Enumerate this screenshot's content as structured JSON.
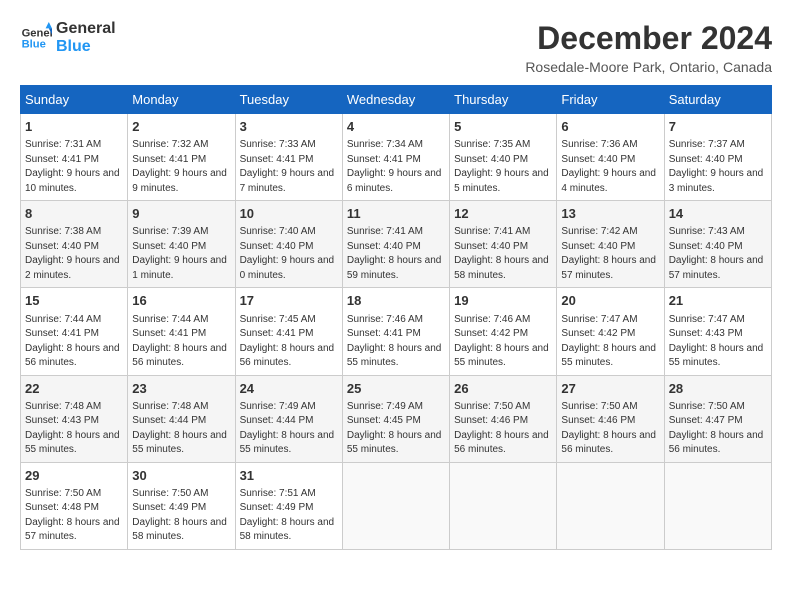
{
  "header": {
    "logo_line1": "General",
    "logo_line2": "Blue",
    "month": "December 2024",
    "location": "Rosedale-Moore Park, Ontario, Canada"
  },
  "weekdays": [
    "Sunday",
    "Monday",
    "Tuesday",
    "Wednesday",
    "Thursday",
    "Friday",
    "Saturday"
  ],
  "weeks": [
    [
      {
        "day": "1",
        "info": "Sunrise: 7:31 AM\nSunset: 4:41 PM\nDaylight: 9 hours and 10 minutes."
      },
      {
        "day": "2",
        "info": "Sunrise: 7:32 AM\nSunset: 4:41 PM\nDaylight: 9 hours and 9 minutes."
      },
      {
        "day": "3",
        "info": "Sunrise: 7:33 AM\nSunset: 4:41 PM\nDaylight: 9 hours and 7 minutes."
      },
      {
        "day": "4",
        "info": "Sunrise: 7:34 AM\nSunset: 4:41 PM\nDaylight: 9 hours and 6 minutes."
      },
      {
        "day": "5",
        "info": "Sunrise: 7:35 AM\nSunset: 4:40 PM\nDaylight: 9 hours and 5 minutes."
      },
      {
        "day": "6",
        "info": "Sunrise: 7:36 AM\nSunset: 4:40 PM\nDaylight: 9 hours and 4 minutes."
      },
      {
        "day": "7",
        "info": "Sunrise: 7:37 AM\nSunset: 4:40 PM\nDaylight: 9 hours and 3 minutes."
      }
    ],
    [
      {
        "day": "8",
        "info": "Sunrise: 7:38 AM\nSunset: 4:40 PM\nDaylight: 9 hours and 2 minutes."
      },
      {
        "day": "9",
        "info": "Sunrise: 7:39 AM\nSunset: 4:40 PM\nDaylight: 9 hours and 1 minute."
      },
      {
        "day": "10",
        "info": "Sunrise: 7:40 AM\nSunset: 4:40 PM\nDaylight: 9 hours and 0 minutes."
      },
      {
        "day": "11",
        "info": "Sunrise: 7:41 AM\nSunset: 4:40 PM\nDaylight: 8 hours and 59 minutes."
      },
      {
        "day": "12",
        "info": "Sunrise: 7:41 AM\nSunset: 4:40 PM\nDaylight: 8 hours and 58 minutes."
      },
      {
        "day": "13",
        "info": "Sunrise: 7:42 AM\nSunset: 4:40 PM\nDaylight: 8 hours and 57 minutes."
      },
      {
        "day": "14",
        "info": "Sunrise: 7:43 AM\nSunset: 4:40 PM\nDaylight: 8 hours and 57 minutes."
      }
    ],
    [
      {
        "day": "15",
        "info": "Sunrise: 7:44 AM\nSunset: 4:41 PM\nDaylight: 8 hours and 56 minutes."
      },
      {
        "day": "16",
        "info": "Sunrise: 7:44 AM\nSunset: 4:41 PM\nDaylight: 8 hours and 56 minutes."
      },
      {
        "day": "17",
        "info": "Sunrise: 7:45 AM\nSunset: 4:41 PM\nDaylight: 8 hours and 56 minutes."
      },
      {
        "day": "18",
        "info": "Sunrise: 7:46 AM\nSunset: 4:41 PM\nDaylight: 8 hours and 55 minutes."
      },
      {
        "day": "19",
        "info": "Sunrise: 7:46 AM\nSunset: 4:42 PM\nDaylight: 8 hours and 55 minutes."
      },
      {
        "day": "20",
        "info": "Sunrise: 7:47 AM\nSunset: 4:42 PM\nDaylight: 8 hours and 55 minutes."
      },
      {
        "day": "21",
        "info": "Sunrise: 7:47 AM\nSunset: 4:43 PM\nDaylight: 8 hours and 55 minutes."
      }
    ],
    [
      {
        "day": "22",
        "info": "Sunrise: 7:48 AM\nSunset: 4:43 PM\nDaylight: 8 hours and 55 minutes."
      },
      {
        "day": "23",
        "info": "Sunrise: 7:48 AM\nSunset: 4:44 PM\nDaylight: 8 hours and 55 minutes."
      },
      {
        "day": "24",
        "info": "Sunrise: 7:49 AM\nSunset: 4:44 PM\nDaylight: 8 hours and 55 minutes."
      },
      {
        "day": "25",
        "info": "Sunrise: 7:49 AM\nSunset: 4:45 PM\nDaylight: 8 hours and 55 minutes."
      },
      {
        "day": "26",
        "info": "Sunrise: 7:50 AM\nSunset: 4:46 PM\nDaylight: 8 hours and 56 minutes."
      },
      {
        "day": "27",
        "info": "Sunrise: 7:50 AM\nSunset: 4:46 PM\nDaylight: 8 hours and 56 minutes."
      },
      {
        "day": "28",
        "info": "Sunrise: 7:50 AM\nSunset: 4:47 PM\nDaylight: 8 hours and 56 minutes."
      }
    ],
    [
      {
        "day": "29",
        "info": "Sunrise: 7:50 AM\nSunset: 4:48 PM\nDaylight: 8 hours and 57 minutes."
      },
      {
        "day": "30",
        "info": "Sunrise: 7:50 AM\nSunset: 4:49 PM\nDaylight: 8 hours and 58 minutes."
      },
      {
        "day": "31",
        "info": "Sunrise: 7:51 AM\nSunset: 4:49 PM\nDaylight: 8 hours and 58 minutes."
      },
      {
        "day": "",
        "info": ""
      },
      {
        "day": "",
        "info": ""
      },
      {
        "day": "",
        "info": ""
      },
      {
        "day": "",
        "info": ""
      }
    ]
  ]
}
